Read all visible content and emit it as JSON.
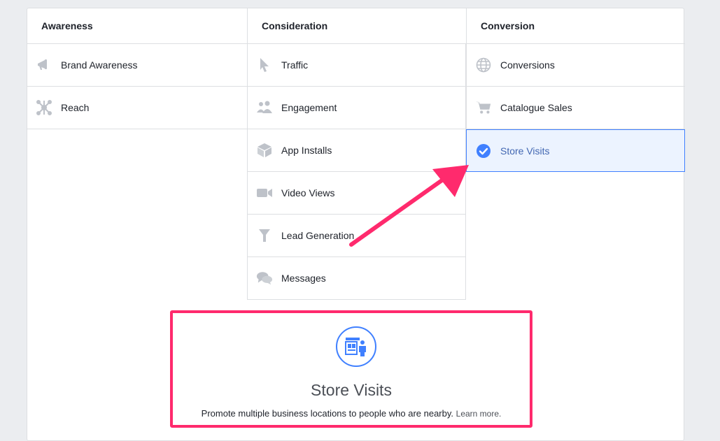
{
  "columns": [
    {
      "title": "Awareness",
      "items": [
        {
          "label": "Brand Awareness",
          "icon": "megaphone-icon"
        },
        {
          "label": "Reach",
          "icon": "reach-icon"
        }
      ]
    },
    {
      "title": "Consideration",
      "items": [
        {
          "label": "Traffic",
          "icon": "cursor-icon"
        },
        {
          "label": "Engagement",
          "icon": "people-icon"
        },
        {
          "label": "App Installs",
          "icon": "box-icon"
        },
        {
          "label": "Video Views",
          "icon": "video-camera-icon"
        },
        {
          "label": "Lead Generation",
          "icon": "funnel-icon"
        },
        {
          "label": "Messages",
          "icon": "chat-bubbles-icon"
        }
      ]
    },
    {
      "title": "Conversion",
      "items": [
        {
          "label": "Conversions",
          "icon": "globe-icon"
        },
        {
          "label": "Catalogue Sales",
          "icon": "cart-icon"
        },
        {
          "label": "Store Visits",
          "icon": "check-circle-icon",
          "selected": true
        }
      ]
    }
  ],
  "detail": {
    "icon": "store-person-icon",
    "title": "Store Visits",
    "description": "Promote multiple business locations to people who are nearby.",
    "link": "Learn more."
  },
  "colors": {
    "selected_border": "#4080ff",
    "selected_bg": "#ecf3ff",
    "annotation": "#ff2a6d",
    "icon_gray": "#bec2c9"
  }
}
